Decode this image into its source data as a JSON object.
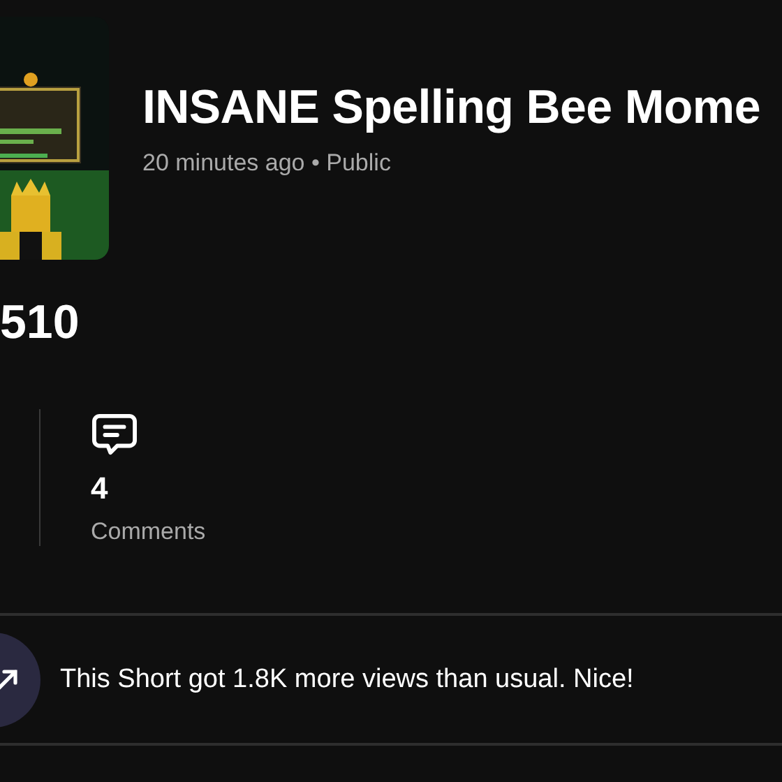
{
  "video": {
    "title": "INSANE Spelling Bee Mome",
    "meta": "20 minutes ago • Public"
  },
  "views": {
    "value": "510"
  },
  "comments": {
    "value": "4",
    "label": "Comments"
  },
  "insight": {
    "text": "This Short got 1.8K more views than usual. Nice!"
  }
}
